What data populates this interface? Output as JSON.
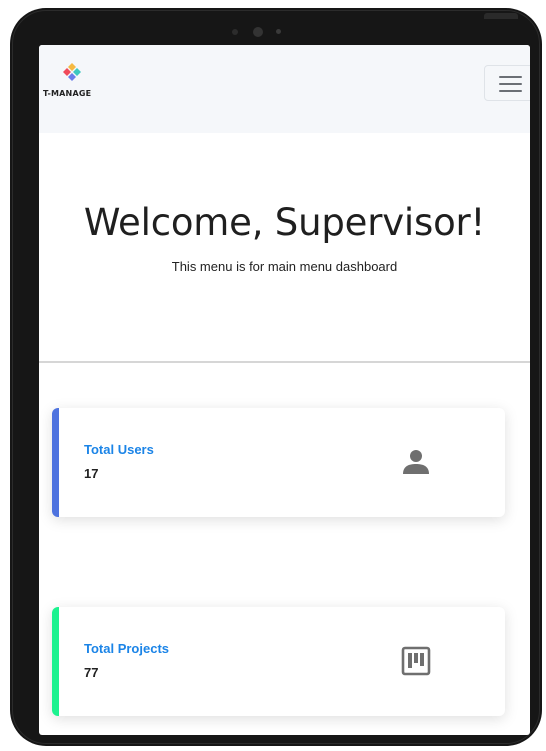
{
  "navbar": {
    "brand_name": "T-MANAGE"
  },
  "hero": {
    "title": "Welcome, Supervisor!",
    "subtitle": "This menu is for main menu dashboard"
  },
  "cards": [
    {
      "label": "Total Users",
      "value": "17",
      "icon": "user-icon",
      "accent_color": "#4e73df"
    },
    {
      "label": "Total Projects",
      "value": "77",
      "icon": "kanban-icon",
      "accent_color": "#1cf28f"
    }
  ],
  "colors": {
    "link_blue": "#1b84e7",
    "navbar_bg": "#f5f7fa",
    "device_frame": "#161616"
  }
}
